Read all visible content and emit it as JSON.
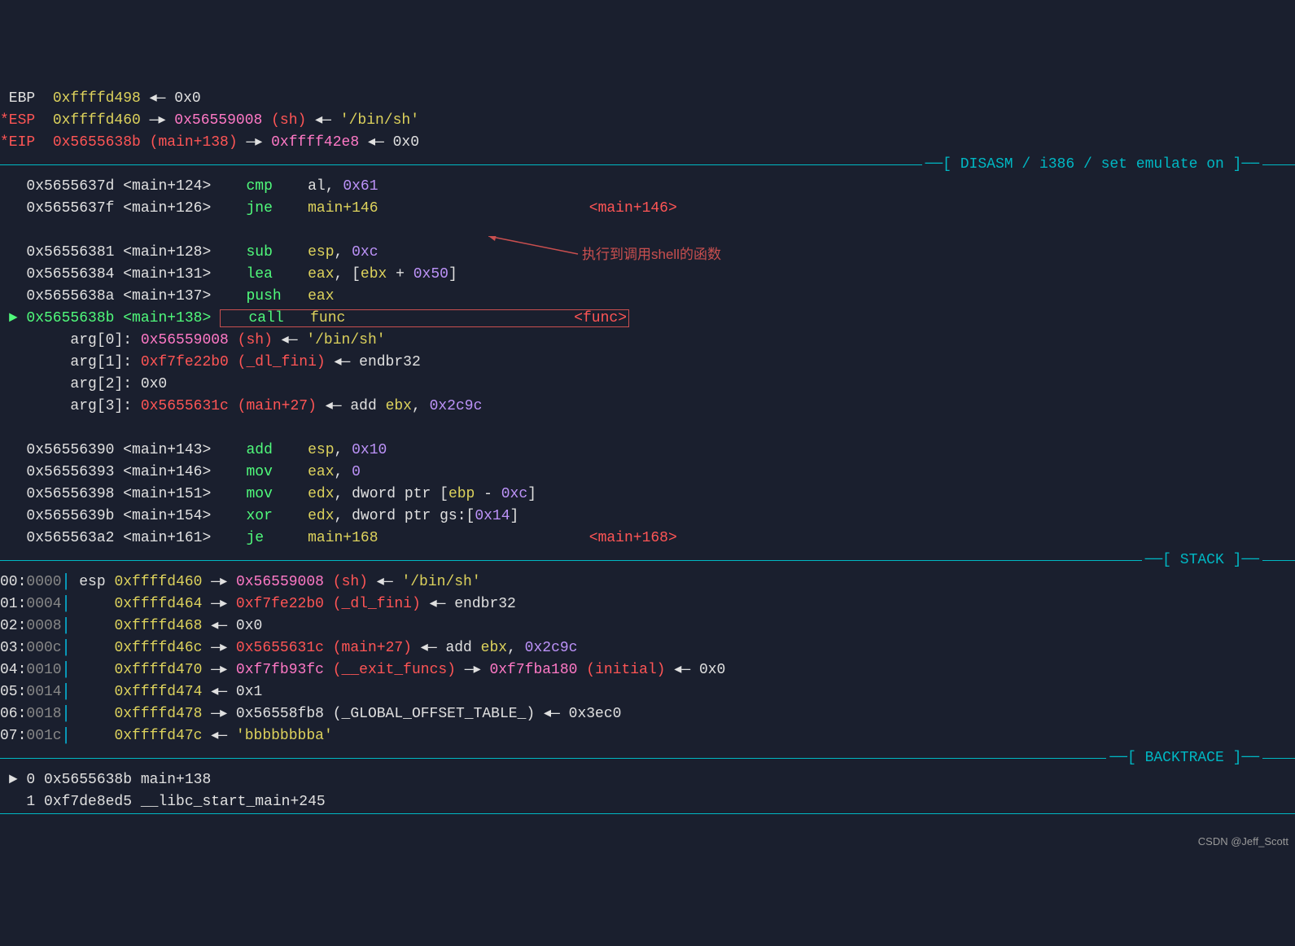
{
  "registers": {
    "ebp_label": " EBP  ",
    "ebp_addr": "0xffffd498",
    "ebp_arrow": " ◂— ",
    "ebp_val": "0x0",
    "esp_label": "*ESP  ",
    "esp_addr": "0xffffd460",
    "esp_arrow1": " —▸ ",
    "esp_ptr": "0x56559008",
    "esp_sym": " (sh)",
    "esp_arrow2": " ◂— ",
    "esp_str": "'/bin/sh'",
    "eip_label": "*EIP  ",
    "eip_addr": "0x5655638b",
    "eip_sym": " (main+138)",
    "eip_arrow1": " —▸ ",
    "eip_ptr": "0xffff42e8",
    "eip_arrow2": " ◂— ",
    "eip_val": "0x0"
  },
  "section_disasm": "[ DISASM / i386 / set emulate on ]",
  "disasm": [
    {
      "prefix": "   ",
      "addr": "0x5655637d",
      "sym": " <main+124>",
      "mnem": "    cmp    ",
      "ops": [
        {
          "t": "al",
          "c": "white"
        },
        {
          "t": ", ",
          "c": "white"
        },
        {
          "t": "0x61",
          "c": "purple"
        }
      ]
    },
    {
      "prefix": "   ",
      "addr": "0x5655637f",
      "sym": " <main+126>",
      "mnem": "    jne    ",
      "ops": [
        {
          "t": "main+146",
          "c": "yellow"
        },
        {
          "t": "                        ",
          "c": "white"
        },
        {
          "t": "<main+146>",
          "c": "red"
        }
      ]
    },
    {
      "blank": true
    },
    {
      "prefix": "   ",
      "addr": "0x56556381",
      "sym": " <main+128>",
      "mnem": "    sub    ",
      "ops": [
        {
          "t": "esp",
          "c": "yellow"
        },
        {
          "t": ", ",
          "c": "white"
        },
        {
          "t": "0xc",
          "c": "purple"
        }
      ]
    },
    {
      "prefix": "   ",
      "addr": "0x56556384",
      "sym": " <main+131>",
      "mnem": "    lea    ",
      "ops": [
        {
          "t": "eax",
          "c": "yellow"
        },
        {
          "t": ", [",
          "c": "white"
        },
        {
          "t": "ebx",
          "c": "yellow"
        },
        {
          "t": " + ",
          "c": "white"
        },
        {
          "t": "0x50",
          "c": "purple"
        },
        {
          "t": "]",
          "c": "white"
        }
      ]
    },
    {
      "prefix": "   ",
      "addr": "0x5655638a",
      "sym": " <main+137>",
      "mnem": "    push   ",
      "ops": [
        {
          "t": "eax",
          "c": "yellow"
        }
      ]
    },
    {
      "prefix": " ► ",
      "addr_cur": "0x5655638b",
      "sym_cur": " <main+138>",
      "mnem_box": "   call   ",
      "ops_box": [
        {
          "t": "func",
          "c": "yellow"
        },
        {
          "t": "                          ",
          "c": "white"
        },
        {
          "t": "<func>",
          "c": "red"
        }
      ]
    },
    {
      "raw": true,
      "segments": [
        {
          "t": "        arg[0]: ",
          "c": "white"
        },
        {
          "t": "0x56559008",
          "c": "magenta"
        },
        {
          "t": " (sh)",
          "c": "red"
        },
        {
          "t": " ◂— ",
          "c": "white"
        },
        {
          "t": "'/bin/sh'",
          "c": "yellow"
        }
      ]
    },
    {
      "raw": true,
      "segments": [
        {
          "t": "        arg[1]: ",
          "c": "white"
        },
        {
          "t": "0xf7fe22b0",
          "c": "red"
        },
        {
          "t": " (_dl_fini)",
          "c": "red"
        },
        {
          "t": " ◂— ",
          "c": "white"
        },
        {
          "t": "endbr32",
          "c": "white"
        }
      ]
    },
    {
      "raw": true,
      "segments": [
        {
          "t": "        arg[2]: ",
          "c": "white"
        },
        {
          "t": "0x0",
          "c": "white"
        }
      ]
    },
    {
      "raw": true,
      "segments": [
        {
          "t": "        arg[3]: ",
          "c": "white"
        },
        {
          "t": "0x5655631c",
          "c": "red"
        },
        {
          "t": " (main+27)",
          "c": "red"
        },
        {
          "t": " ◂— ",
          "c": "white"
        },
        {
          "t": "add ",
          "c": "white"
        },
        {
          "t": "ebx",
          "c": "yellow"
        },
        {
          "t": ", ",
          "c": "white"
        },
        {
          "t": "0x2c9c",
          "c": "purple"
        }
      ]
    },
    {
      "blank": true
    },
    {
      "prefix": "   ",
      "addr": "0x56556390",
      "sym": " <main+143>",
      "mnem": "    add    ",
      "ops": [
        {
          "t": "esp",
          "c": "yellow"
        },
        {
          "t": ", ",
          "c": "white"
        },
        {
          "t": "0x10",
          "c": "purple"
        }
      ]
    },
    {
      "prefix": "   ",
      "addr": "0x56556393",
      "sym": " <main+146>",
      "mnem": "    mov    ",
      "ops": [
        {
          "t": "eax",
          "c": "yellow"
        },
        {
          "t": ", ",
          "c": "white"
        },
        {
          "t": "0",
          "c": "purple"
        }
      ]
    },
    {
      "prefix": "   ",
      "addr": "0x56556398",
      "sym": " <main+151>",
      "mnem": "    mov    ",
      "ops": [
        {
          "t": "edx",
          "c": "yellow"
        },
        {
          "t": ", dword ptr [",
          "c": "white"
        },
        {
          "t": "ebp",
          "c": "yellow"
        },
        {
          "t": " - ",
          "c": "white"
        },
        {
          "t": "0xc",
          "c": "purple"
        },
        {
          "t": "]",
          "c": "white"
        }
      ]
    },
    {
      "prefix": "   ",
      "addr": "0x5655639b",
      "sym": " <main+154>",
      "mnem": "    xor    ",
      "ops": [
        {
          "t": "edx",
          "c": "yellow"
        },
        {
          "t": ", dword ptr gs:[",
          "c": "white"
        },
        {
          "t": "0x14",
          "c": "purple"
        },
        {
          "t": "]",
          "c": "white"
        }
      ]
    },
    {
      "prefix": "   ",
      "addr": "0x565563a2",
      "sym": " <main+161>",
      "mnem": "    je     ",
      "ops": [
        {
          "t": "main+168",
          "c": "yellow"
        },
        {
          "t": "                        ",
          "c": "white"
        },
        {
          "t": "<main+168>",
          "c": "red"
        }
      ]
    }
  ],
  "annotation_text": "执行到调用shell的函数",
  "section_stack": "[ STACK ]",
  "stack": [
    {
      "off": "00:",
      "hex": "0000",
      "bar": "│ ",
      "reg": "esp ",
      "addr": "0xffffd460",
      "arrow": " —▸ ",
      "segments": [
        {
          "t": "0x56559008",
          "c": "magenta"
        },
        {
          "t": " (sh)",
          "c": "red"
        },
        {
          "t": " ◂— ",
          "c": "white"
        },
        {
          "t": "'/bin/sh'",
          "c": "yellow"
        }
      ]
    },
    {
      "off": "01:",
      "hex": "0004",
      "bar": "│     ",
      "addr": "0xffffd464",
      "arrow": " —▸ ",
      "segments": [
        {
          "t": "0xf7fe22b0",
          "c": "red"
        },
        {
          "t": " (_dl_fini)",
          "c": "red"
        },
        {
          "t": " ◂— ",
          "c": "white"
        },
        {
          "t": "endbr32",
          "c": "white"
        }
      ]
    },
    {
      "off": "02:",
      "hex": "0008",
      "bar": "│     ",
      "addr": "0xffffd468",
      "arrow": " ◂— ",
      "segments": [
        {
          "t": "0x0",
          "c": "white"
        }
      ]
    },
    {
      "off": "03:",
      "hex": "000c",
      "bar": "│     ",
      "addr": "0xffffd46c",
      "arrow": " —▸ ",
      "segments": [
        {
          "t": "0x5655631c",
          "c": "red"
        },
        {
          "t": " (main+27)",
          "c": "red"
        },
        {
          "t": " ◂— ",
          "c": "white"
        },
        {
          "t": "add ",
          "c": "white"
        },
        {
          "t": "ebx",
          "c": "yellow"
        },
        {
          "t": ", ",
          "c": "white"
        },
        {
          "t": "0x2c9c",
          "c": "purple"
        }
      ]
    },
    {
      "off": "04:",
      "hex": "0010",
      "bar": "│     ",
      "addr": "0xffffd470",
      "arrow": " —▸ ",
      "segments": [
        {
          "t": "0xf7fb93fc",
          "c": "magenta"
        },
        {
          "t": " (__exit_funcs)",
          "c": "red"
        },
        {
          "t": " —▸ ",
          "c": "white"
        },
        {
          "t": "0xf7fba180",
          "c": "magenta"
        },
        {
          "t": " (initial)",
          "c": "red"
        },
        {
          "t": " ◂— ",
          "c": "white"
        },
        {
          "t": "0x0",
          "c": "white"
        }
      ]
    },
    {
      "off": "05:",
      "hex": "0014",
      "bar": "│     ",
      "addr": "0xffffd474",
      "arrow": " ◂— ",
      "segments": [
        {
          "t": "0x1",
          "c": "white"
        }
      ]
    },
    {
      "off": "06:",
      "hex": "0018",
      "bar": "│     ",
      "addr": "0xffffd478",
      "arrow": " —▸ ",
      "segments": [
        {
          "t": "0x56558fb8 (_GLOBAL_OFFSET_TABLE_)",
          "c": "white"
        },
        {
          "t": " ◂— ",
          "c": "white"
        },
        {
          "t": "0x3ec0",
          "c": "white"
        }
      ]
    },
    {
      "off": "07:",
      "hex": "001c",
      "bar": "│     ",
      "addr": "0xffffd47c",
      "arrow": " ◂— ",
      "segments": [
        {
          "t": "'bbbbbbbba'",
          "c": "yellow"
        }
      ]
    }
  ],
  "section_bt": "[ BACKTRACE ]",
  "backtrace": [
    {
      "marker": " ► ",
      "idx": "0",
      "addr": " 0x5655638b ",
      "sym": "main+138"
    },
    {
      "marker": "   ",
      "idx": "1",
      "addr": " 0xf7de8ed5 ",
      "sym": "__libc_start_main+245"
    }
  ],
  "watermark": "CSDN @Jeff_Scott"
}
